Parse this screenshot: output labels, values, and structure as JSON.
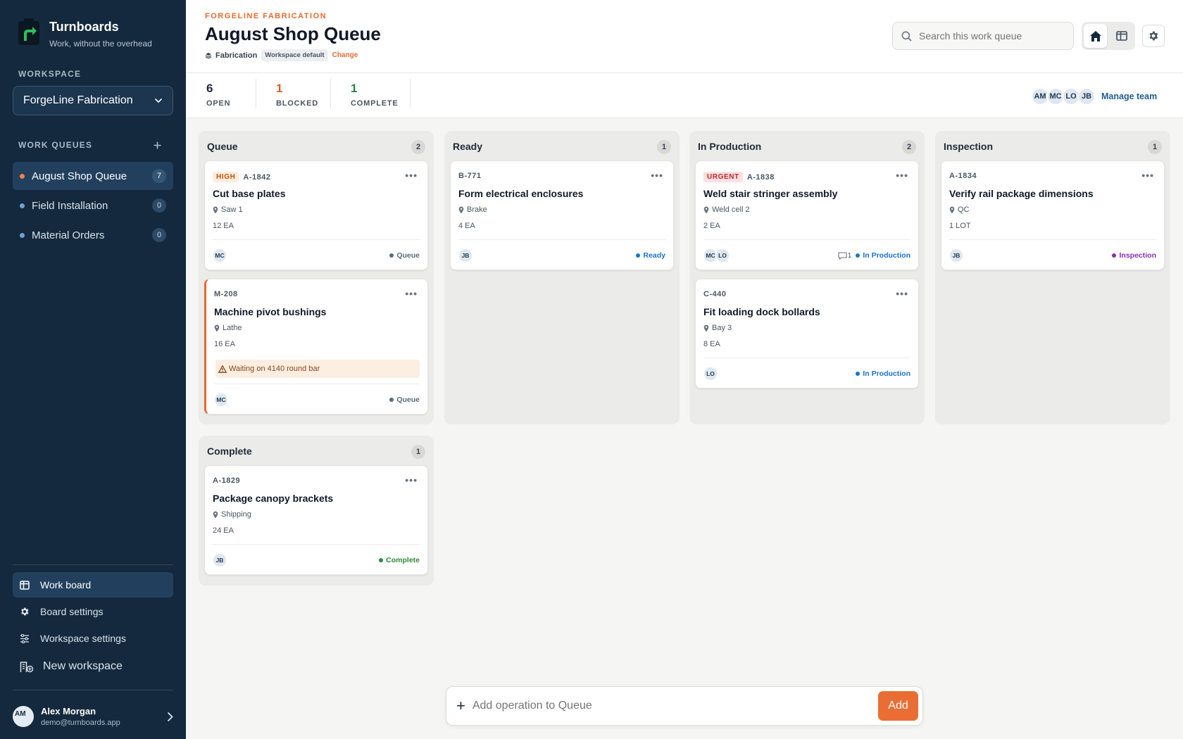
{
  "app": {
    "name": "Turnboards",
    "tagline": "Work, without the overhead"
  },
  "sidebar": {
    "workspace_title": "WORKSPACE",
    "workspace_value": "ForgeLine Fabrication",
    "queues_title": "WORK QUEUES",
    "queues": [
      {
        "label": "August Shop Queue",
        "count": "7",
        "active": true
      },
      {
        "label": "Field Installation",
        "count": "0"
      },
      {
        "label": "Material Orders",
        "count": "0"
      }
    ],
    "nav": [
      {
        "label": "Work board",
        "icon": "board-icon",
        "active": true
      },
      {
        "label": "Board settings",
        "icon": "gear-icon"
      },
      {
        "label": "Workspace settings",
        "icon": "sliders-icon"
      },
      {
        "label": "New workspace",
        "icon": "building-plus-icon"
      }
    ],
    "user": {
      "initials": "AM",
      "name": "Alex Morgan",
      "email": "demo@turnboards.app"
    }
  },
  "header": {
    "org": "FORGELINE FABRICATION",
    "title": "August Shop Queue",
    "category": "Fabrication",
    "badge": "Workspace default",
    "change": "Change",
    "search_placeholder": "Search this work queue"
  },
  "stats": [
    {
      "value": "6",
      "label": "OPEN",
      "color": "#1f2937"
    },
    {
      "value": "1",
      "label": "BLOCKED",
      "color": "#d9602a"
    },
    {
      "value": "1",
      "label": "COMPLETE",
      "color": "#2f7d4b"
    }
  ],
  "team": {
    "members": [
      "AM",
      "MC",
      "LO",
      "JB"
    ],
    "manage_label": "Manage team"
  },
  "columns": [
    {
      "name": "Queue",
      "count": "2"
    },
    {
      "name": "Ready",
      "count": "1"
    },
    {
      "name": "In Production",
      "count": "2"
    },
    {
      "name": "Inspection",
      "count": "1"
    },
    {
      "name": "Complete",
      "count": "1"
    }
  ],
  "cards": [
    {
      "priority": "HIGH",
      "code": "A-1842",
      "title": "Cut base plates",
      "location": "Saw 1",
      "qty": "12 EA",
      "assignees": [
        "MC"
      ],
      "status": "Queue",
      "status_color": "#5a6b7b"
    },
    {
      "code": "M-208",
      "title": "Machine pivot bushings",
      "location": "Lathe",
      "qty": "16 EA",
      "warning": "Waiting on 4140 round bar",
      "assignees": [
        "MC"
      ],
      "status": "Queue",
      "status_color": "#5a6b7b"
    },
    {
      "code": "B-771",
      "title": "Form electrical enclosures",
      "location": "Brake",
      "qty": "4 EA",
      "assignees": [
        "JB"
      ],
      "status": "Ready",
      "status_color": "#1a73c9"
    },
    {
      "priority": "URGENT",
      "code": "A-1838",
      "title": "Weld stair stringer assembly",
      "location": "Weld cell 2",
      "qty": "2 EA",
      "assignees": [
        "MC",
        "LO"
      ],
      "comments": "1",
      "status": "In Production",
      "status_color": "#1a73c9"
    },
    {
      "code": "C-440",
      "title": "Fit loading dock bollards",
      "location": "Bay 3",
      "qty": "8 EA",
      "assignees": [
        "LO"
      ],
      "status": "In Production",
      "status_color": "#1a73c9"
    },
    {
      "code": "A-1834",
      "title": "Verify rail package dimensions",
      "location": "QC",
      "qty": "1 LOT",
      "assignees": [
        "JB"
      ],
      "status": "Inspection",
      "status_color": "#8b2bb5"
    },
    {
      "code": "A-1829",
      "title": "Package canopy brackets",
      "location": "Shipping",
      "qty": "24 EA",
      "assignees": [
        "JB"
      ],
      "status": "Complete",
      "status_color": "#2f8a3e"
    }
  ],
  "add_bar": {
    "placeholder": "Add operation to Queue",
    "button": "Add"
  }
}
